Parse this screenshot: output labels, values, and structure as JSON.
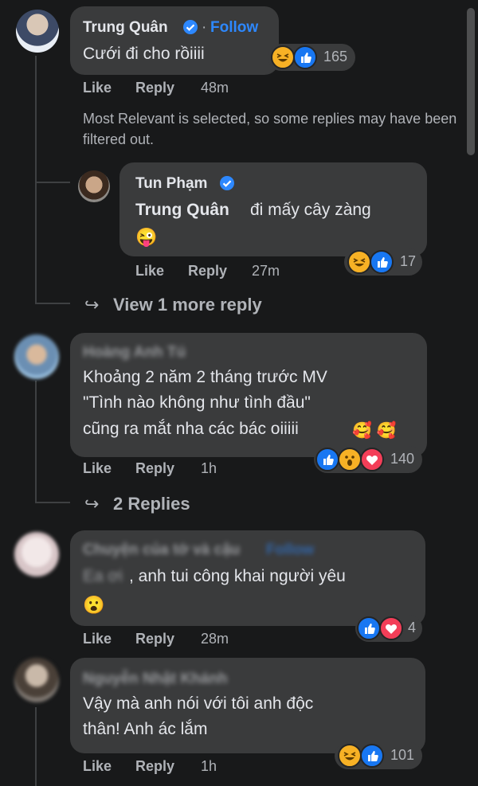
{
  "comments": [
    {
      "author": "Trung Quân",
      "verified": true,
      "follow_label": "Follow",
      "text": "Cưới đi cho rồiiii",
      "reactions": [
        "haha",
        "like"
      ],
      "reaction_count": "165",
      "like_label": "Like",
      "reply_label": "Reply",
      "time": "48m",
      "filter_note": "Most Relevant is selected, so some replies may have been filtered out.",
      "replies": [
        {
          "author": "Tun Phạm",
          "verified": true,
          "mention": "Trung Quân",
          "text": "đi mấy cây zàng",
          "emoji": "😜",
          "reactions": [
            "haha",
            "like"
          ],
          "reaction_count": "17",
          "like_label": "Like",
          "reply_label": "Reply",
          "time": "27m"
        }
      ],
      "more_replies_label": "View 1 more reply"
    },
    {
      "author": "Hoàng Anh Tú",
      "text_lines": [
        "Khoảng 2 năm 2 tháng trước MV",
        "\"Tình nào không như tình đầu\"",
        "cũng ra mắt nha các bác oiiiii"
      ],
      "emoji": "🥰 🥰",
      "reactions": [
        "like",
        "wow",
        "love"
      ],
      "reaction_count": "140",
      "like_label": "Like",
      "reply_label": "Reply",
      "time": "1h",
      "more_replies_label": "2 Replies"
    },
    {
      "author": "Chuyện của tớ và cậu",
      "follow_label": "Follow",
      "text_prefix": "Ea ơi",
      "text": ", anh tui công khai người yêu",
      "emoji": "😮",
      "reactions": [
        "like",
        "love"
      ],
      "reaction_count": "4",
      "like_label": "Like",
      "reply_label": "Reply",
      "time": "28m"
    },
    {
      "author": "Nguyễn Nhật Khánh",
      "text_lines": [
        "Vậy mà anh nói với tôi anh độc",
        "thân! Anh ác lắm"
      ],
      "reactions": [
        "haha",
        "like"
      ],
      "reaction_count": "101",
      "like_label": "Like",
      "reply_label": "Reply",
      "time": "1h"
    }
  ],
  "colors": {
    "background": "#18191a",
    "bubble": "#3a3b3c",
    "link": "#2d88ff",
    "muted": "#b0b3b8",
    "like": "#1877f2",
    "love": "#f33e58",
    "haha": "#f7b125"
  }
}
